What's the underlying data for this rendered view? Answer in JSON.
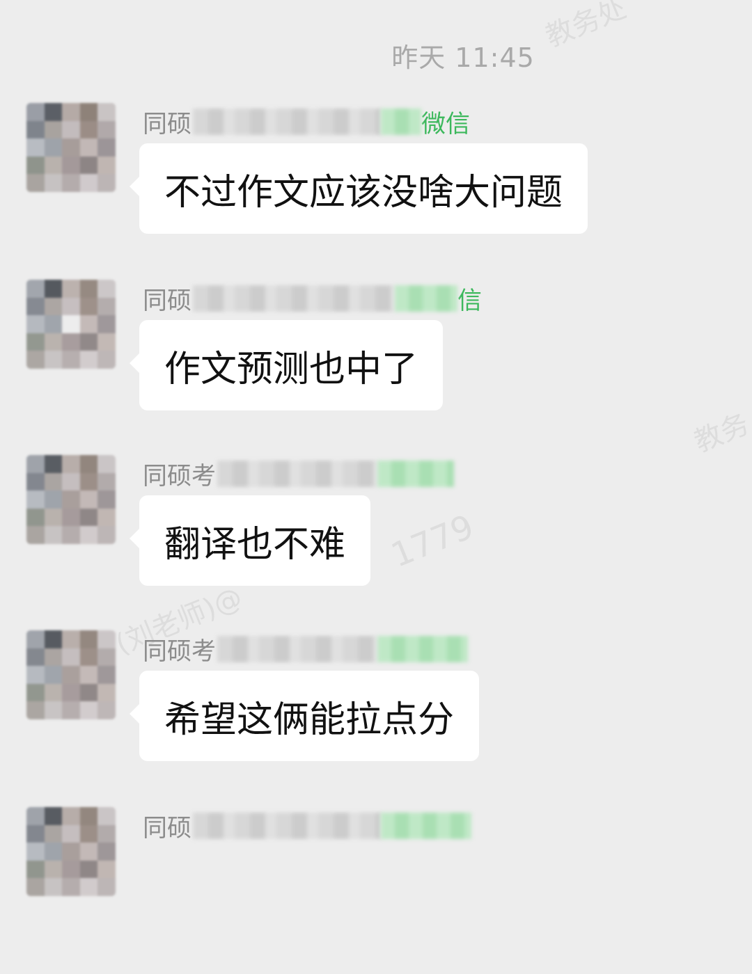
{
  "timestamp": "昨天 11:45",
  "messages": [
    {
      "sender_prefix": "同硕",
      "sender_suffix": "微信",
      "text": "不过作文应该没啥大问题"
    },
    {
      "sender_prefix": "同硕",
      "sender_suffix": "信",
      "text": "作文预测也中了"
    },
    {
      "sender_prefix": "同硕考",
      "sender_suffix": "",
      "text": "翻译也不难"
    },
    {
      "sender_prefix": "同硕考",
      "sender_suffix": "",
      "text": "希望这俩能拉点分"
    },
    {
      "sender_prefix": "同硕",
      "sender_suffix": "",
      "text": ""
    }
  ],
  "watermarks": [
    "教务处",
    "教务",
    "1779",
    "(刘老师)@"
  ],
  "colors": {
    "background": "#ededed",
    "bubble": "#ffffff",
    "sender_green": "#3cb85c"
  }
}
